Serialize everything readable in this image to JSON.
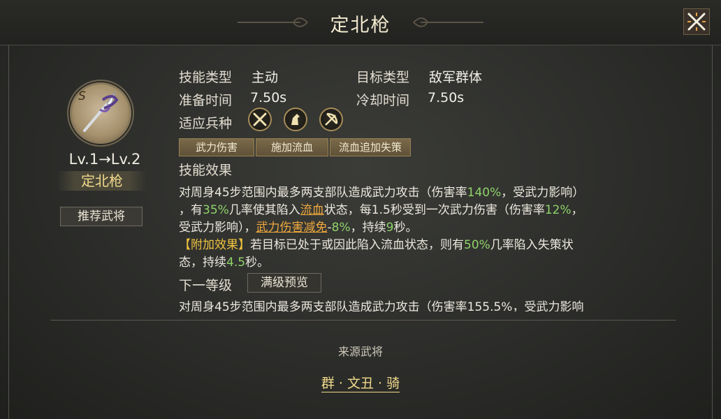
{
  "title": "定北枪",
  "close_icon": "close-icon",
  "skill_icon": {
    "grade": "S",
    "icon": "spear-icon"
  },
  "level": "Lv.1→Lv.2",
  "name": "定北枪",
  "recommend_button": "推荐武将",
  "info": {
    "skill_type_label": "技能类型",
    "skill_type_value": "主动",
    "target_type_label": "目标类型",
    "target_type_value": "敌军群体",
    "prep_time_label": "准备时间",
    "prep_time_value": "7.50s",
    "cooldown_label": "冷却时间",
    "cooldown_value": "7.50s",
    "troop_label": "适应兵种",
    "troops": [
      "spear-icon",
      "cavalry-icon",
      "archer-icon"
    ]
  },
  "tags": [
    "武力伤害",
    "施加流血",
    "流血追加失策"
  ],
  "effect_label": "技能效果",
  "effect": {
    "l1a": "对周身45步范围内最多两支部队造成武力攻击（伤害率",
    "l1b": "140%",
    "l1c": "，受武力影响）",
    "l2a": "，有",
    "l2b": "35%",
    "l2c": "几率使其陷入",
    "l2d": "流血",
    "l2e": "状态，每1.5秒受到一次武力伤害（伤害率",
    "l2f": "12%",
    "l2g": "，",
    "l3a": "受武力影响），",
    "l3b": "武力伤害减免",
    "l3c": "-",
    "l3d": "8%",
    "l3e": "，持续",
    "l3f": "9",
    "l3g": "秒。",
    "l4a": "【附加效果】",
    "l4b": "若目标已处于或因此陷入流血状态，则有",
    "l4c": "50%",
    "l4d": "几率陷入失策状",
    "l5a": "态，持续",
    "l5b": "4.5",
    "l5c": "秒。"
  },
  "next_level_label": "下一等级",
  "max_preview_button": "满级预览",
  "next_level_preview": "对周身45步范围内最多两支部队造成武力攻击（伤害率155.5%，受武力影响",
  "source_label": "来源武将",
  "source_link": "群 · 文丑 · 骑",
  "colors": {
    "highlight_green": "#8fd36a",
    "highlight_orange": "#f0a93d",
    "gold": "#f1d98b"
  }
}
